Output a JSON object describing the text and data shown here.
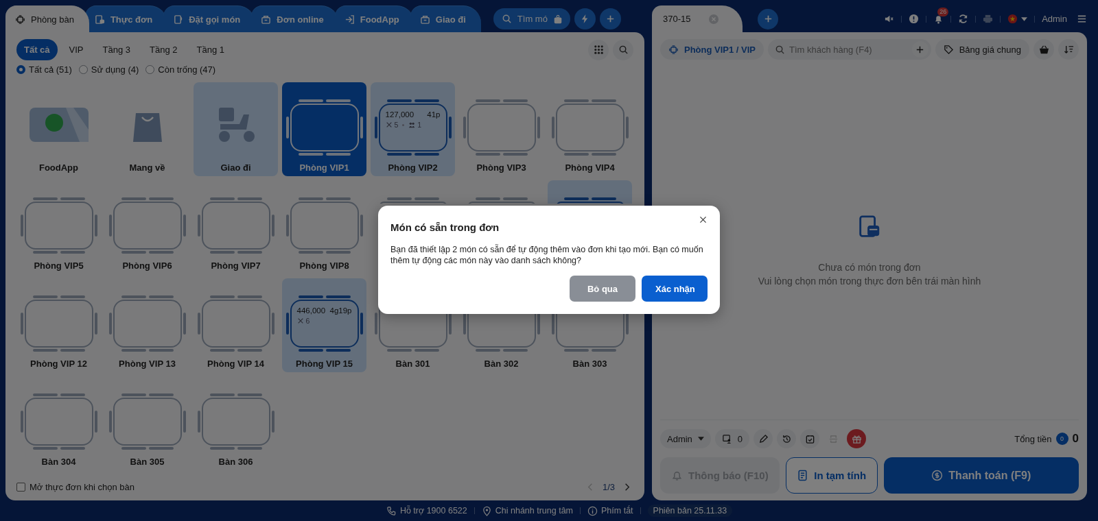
{
  "nav_tabs": [
    {
      "label": "Phòng bàn",
      "selected": true
    },
    {
      "label": "Thực đơn",
      "selected": false
    },
    {
      "label": "Đặt gọi món",
      "selected": false
    },
    {
      "label": "Đơn online",
      "selected": false
    },
    {
      "label": "FoodApp",
      "selected": false
    },
    {
      "label": "Giao đi",
      "selected": false
    }
  ],
  "menu_search": {
    "placeholder": "Tìm mó"
  },
  "areas": [
    {
      "label": "Tất cả",
      "selected": true
    },
    {
      "label": "VIP",
      "selected": false
    },
    {
      "label": "Tầng 3",
      "selected": false
    },
    {
      "label": "Tầng 2",
      "selected": false
    },
    {
      "label": "Tầng 1",
      "selected": false
    }
  ],
  "status_filters": [
    {
      "label": "Tất cả (51)",
      "selected": true
    },
    {
      "label": "Sử dụng (4)",
      "selected": false
    },
    {
      "label": "Còn trống (47)",
      "selected": false
    }
  ],
  "tables": [
    {
      "kind": "app",
      "name": "FoodApp",
      "selected": false,
      "occupied": false
    },
    {
      "kind": "takeaway",
      "name": "Mang về",
      "selected": false,
      "occupied": false
    },
    {
      "kind": "delivery",
      "name": "Giao đi",
      "selected": false,
      "occupied": true
    },
    {
      "kind": "table",
      "name": "Phòng VIP1",
      "selected": true
    },
    {
      "kind": "table",
      "name": "Phòng VIP2",
      "selected": false,
      "occupied": true,
      "amount": "127,000",
      "duration": "41p",
      "dishes": "5",
      "guests": "1"
    },
    {
      "kind": "table",
      "name": "Phòng VIP3",
      "selected": false,
      "occupied": false
    },
    {
      "kind": "table",
      "name": "Phòng VIP4",
      "selected": false,
      "occupied": false
    },
    {
      "kind": "table",
      "name": "Phòng VIP5",
      "selected": false,
      "occupied": false
    },
    {
      "kind": "table",
      "name": "Phòng VIP6",
      "selected": false,
      "occupied": false
    },
    {
      "kind": "table",
      "name": "Phòng VIP7",
      "selected": false,
      "occupied": false
    },
    {
      "kind": "table",
      "name": "Phòng VIP8",
      "selected": false,
      "occupied": false
    },
    {
      "kind": "table",
      "selected": false,
      "occupied": false
    },
    {
      "kind": "table",
      "selected": false,
      "occupied": false
    },
    {
      "kind": "table",
      "selected": false,
      "occupied": true
    },
    {
      "kind": "table",
      "name": "Phòng VIP 12",
      "selected": false,
      "occupied": false
    },
    {
      "kind": "table",
      "name": "Phòng VIP 13",
      "selected": false,
      "occupied": false
    },
    {
      "kind": "table",
      "name": "Phòng VIP 14",
      "selected": false,
      "occupied": false
    },
    {
      "kind": "table",
      "name": "Phòng VIP 15",
      "selected": false,
      "occupied": true,
      "amount": "446,000",
      "duration": "4g19p",
      "dishes": "6"
    },
    {
      "kind": "table",
      "name": "Bàn 301",
      "selected": false,
      "occupied": false
    },
    {
      "kind": "table",
      "name": "Bàn 302",
      "selected": false,
      "occupied": false
    },
    {
      "kind": "table",
      "name": "Bàn 303",
      "selected": false,
      "occupied": false
    },
    {
      "kind": "table",
      "name": "Bàn 304",
      "selected": false,
      "occupied": false
    },
    {
      "kind": "table",
      "name": "Bàn 305",
      "selected": false,
      "occupied": false
    },
    {
      "kind": "table",
      "name": "Bàn 306",
      "selected": false,
      "occupied": false
    }
  ],
  "open_menu_option": {
    "label": "Mở thực đơn khi chọn bàn",
    "checked": false
  },
  "pagination": {
    "page": "1/3",
    "prev_disabled": true
  },
  "order_tabs": [
    {
      "label": "370-15"
    }
  ],
  "notifications_count": "26",
  "printer_disabled": true,
  "user": "Admin",
  "order": {
    "location": "Phòng VIP1 / VIP",
    "customer_search": {
      "placeholder": "Tìm khách hàng (F4)"
    },
    "price_list": "Bảng giá chung",
    "empty_title": "Chưa có món trong đơn",
    "empty_hint": "Vui lòng chọn món trong thực đơn bên trái màn hình",
    "staff": "Admin",
    "customer_count": "0",
    "tools": [
      {
        "kind": "edit",
        "disabled": false
      },
      {
        "kind": "history",
        "disabled": false
      },
      {
        "kind": "schedule",
        "disabled": false
      },
      {
        "kind": "split",
        "disabled": true
      },
      {
        "kind": "gift",
        "disabled": false
      }
    ],
    "total_label": "Tổng tiền",
    "item_count": "0",
    "total": "0",
    "actions": [
      {
        "label": "Thông báo (F10)",
        "kind": "notify",
        "disabled": true
      },
      {
        "label": "In tạm tính",
        "kind": "print",
        "disabled": false
      },
      {
        "label": "Thanh toán (F9)",
        "kind": "pay",
        "disabled": false
      }
    ]
  },
  "footer": [
    {
      "label": "Hỗ trợ 1900 6522",
      "kind": "phone"
    },
    {
      "label": "Chi nhánh trung tâm",
      "kind": "branch"
    },
    {
      "label": "Phím tắt",
      "kind": "shortcuts"
    },
    {
      "label": "Phiên bản 25.11.33",
      "kind": "version"
    }
  ],
  "dialog": {
    "title": "Món có sẵn trong đơn",
    "message": "Bạn đã thiết lập 2 món có sẵn để tự động thêm vào đơn khi tạo mới. Bạn có muốn thêm tự động các món này vào danh sách không?",
    "buttons": [
      {
        "label": "Bỏ qua",
        "kind": "secondary"
      },
      {
        "label": "Xác nhận",
        "kind": "primary"
      }
    ]
  }
}
